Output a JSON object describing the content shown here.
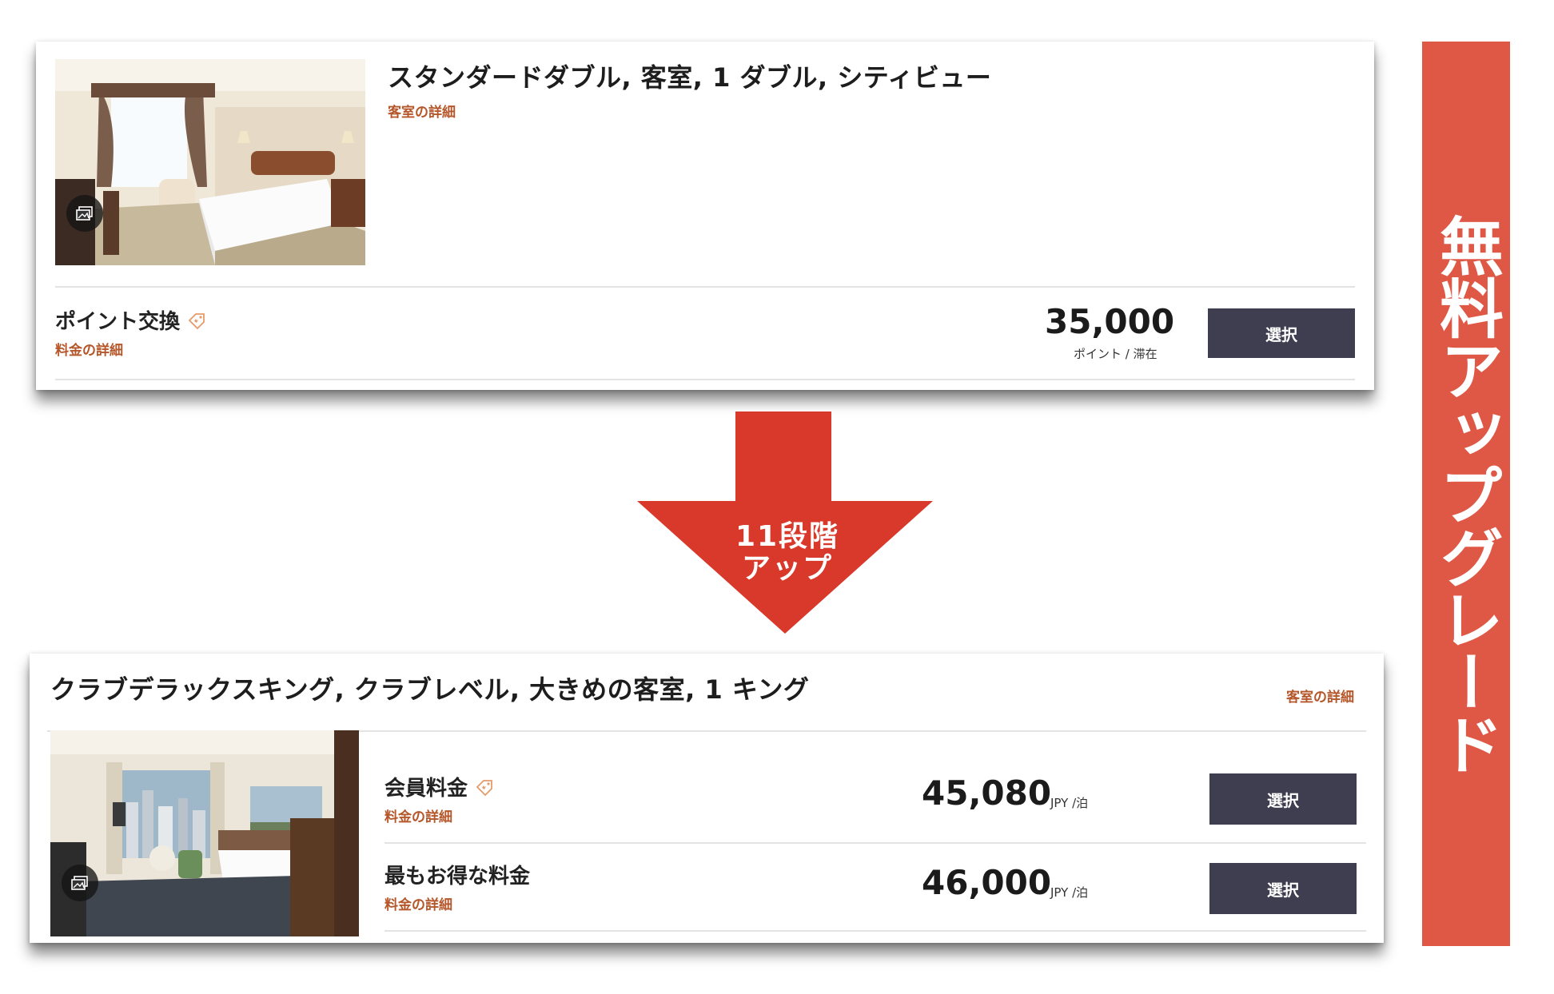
{
  "card_before": {
    "room_title": "スタンダードダブル, 客室, 1 ダブル, シティビュー",
    "room_detail_link": "客室の詳細",
    "rate_name": "ポイント交換",
    "rate_detail_link": "料金の詳細",
    "price": "35,000",
    "price_unit": "ポイント / 滞在",
    "select_label": "選択"
  },
  "arrow": {
    "line1": "11段階",
    "line2": "アップ",
    "color": "#d9392a"
  },
  "card_after": {
    "room_title": "クラブデラックスキング, クラブレベル, 大きめの客室, 1 キング",
    "room_detail_link": "客室の詳細",
    "rates": [
      {
        "name": "会員料金",
        "detail_link": "料金の詳細",
        "price": "45,080",
        "unit": "JPY /泊",
        "select_label": "選択",
        "has_tag": true
      },
      {
        "name": "最もお得な料金",
        "detail_link": "料金の詳細",
        "price": "46,000",
        "unit": "JPY /泊",
        "select_label": "選択",
        "has_tag": false
      }
    ]
  },
  "banner": {
    "text": "無料アップグレード",
    "color": "#df5745"
  },
  "colors": {
    "button_bg": "#3f3d50",
    "link": "#b5572a"
  }
}
